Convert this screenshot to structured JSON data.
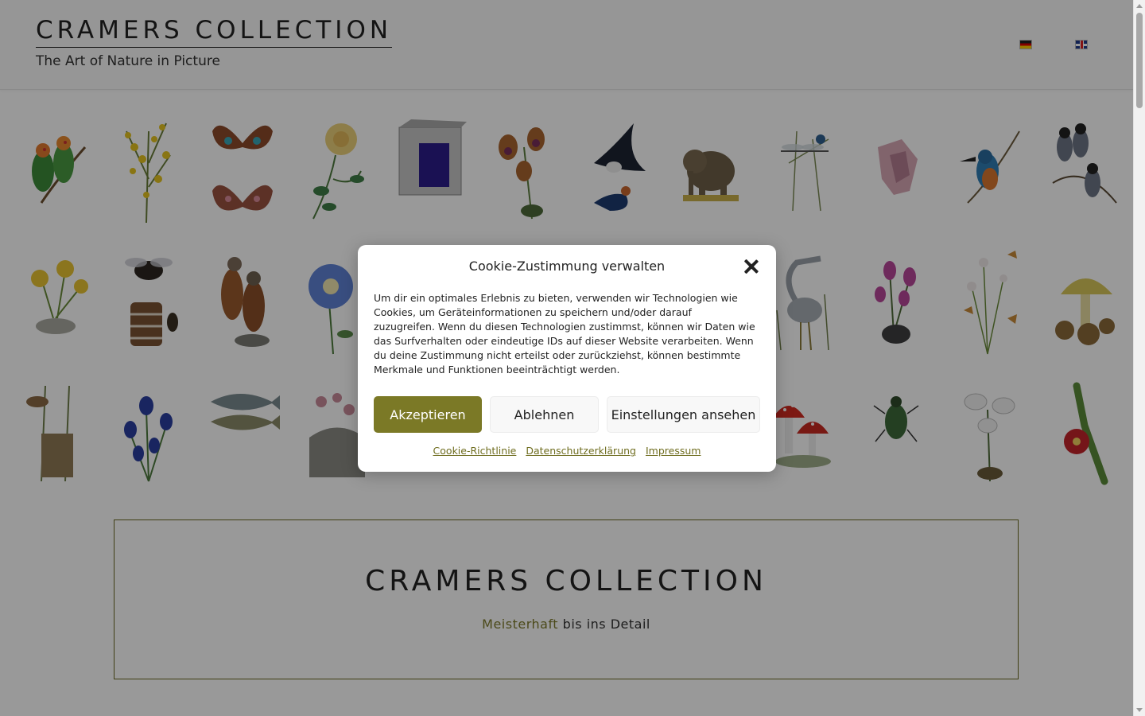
{
  "header": {
    "site_title": "CRAMERS COLLECTION",
    "tagline": "The Art of Nature in Picture",
    "languages": [
      {
        "name": "Deutsch",
        "icon": "german-flag-icon"
      },
      {
        "name": "English",
        "icon": "uk-flag-icon"
      }
    ]
  },
  "gallery": {
    "rows": [
      [
        "lovebirds",
        "yellow-broom-flower",
        "butterflies",
        "yellow-rose",
        "purple-mineral-crystal",
        "orchid",
        "swallows",
        "elephant",
        "dragonfly",
        "pink-mineral",
        "kingfisher",
        "java-sparrows"
      ],
      [
        "yellow-poppies",
        "bumblebee-nest",
        "kestrels",
        "blue-flower",
        "hidden",
        "hidden",
        "hidden",
        "hidden",
        "grey-heron",
        "pink-orchid",
        "meadow-flowers-butterflies",
        "yellow-mushrooms"
      ],
      [
        "reed-warbler-nest",
        "gentian",
        "trout",
        "sempervivum",
        "hidden",
        "hidden",
        "hidden",
        "hidden",
        "fly-agaric",
        "ground-beetle",
        "white-orchid",
        "red-cactus-flower"
      ]
    ]
  },
  "intro": {
    "title": "CRAMERS COLLECTION",
    "subtitle_highlight": "Meisterhaft",
    "subtitle_rest": " bis ins Detail"
  },
  "cookie_modal": {
    "title": "Cookie-Zustimmung verwalten",
    "body": "Um dir ein optimales Erlebnis zu bieten, verwenden wir Technologien wie Cookies, um Geräteinformationen zu speichern und/oder darauf zuzugreifen. Wenn du diesen Technologien zustimmst, können wir Daten wie das Surfverhalten oder eindeutige IDs auf dieser Website verarbeiten. Wenn du deine Zustimmung nicht erteilst oder zurückziehst, können bestimmte Merkmale und Funktionen beeinträchtigt werden.",
    "accept_label": "Akzeptieren",
    "deny_label": "Ablehnen",
    "settings_label": "Einstellungen ansehen",
    "links": {
      "cookie_policy": "Cookie-Richtlinie",
      "privacy": "Datenschutzerklärung",
      "imprint": "Impressum"
    },
    "accent_color": "#7b7926"
  }
}
